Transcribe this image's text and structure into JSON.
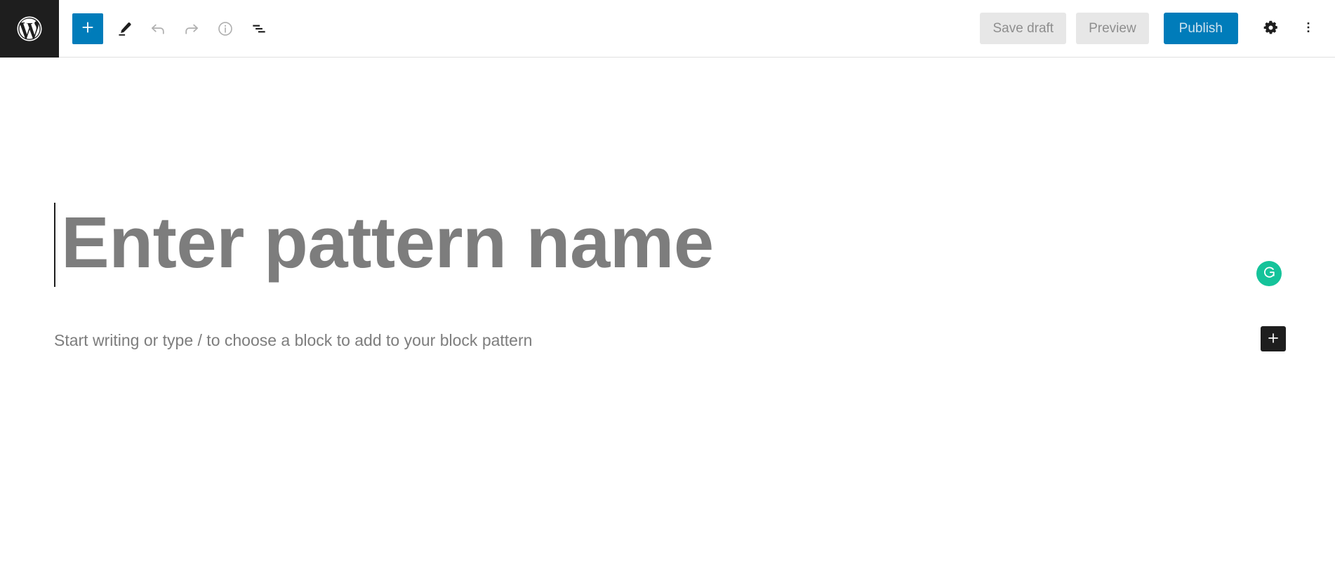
{
  "header": {
    "logo": {
      "icon": "wordpress-logo-icon",
      "label": "WordPress"
    },
    "left_tools": [
      {
        "icon": "plus-icon",
        "label": "Toggle block inserter",
        "state": "active"
      },
      {
        "icon": "pencil-icon",
        "label": "Tools",
        "state": "enabled"
      },
      {
        "icon": "undo-arrow-icon",
        "label": "Undo",
        "state": "disabled"
      },
      {
        "icon": "redo-arrow-icon",
        "label": "Redo",
        "state": "disabled"
      },
      {
        "icon": "info-circle-icon",
        "label": "Details",
        "state": "disabled"
      },
      {
        "icon": "list-view-icon",
        "label": "List View",
        "state": "enabled"
      }
    ],
    "right_tools": {
      "save_draft_label": "Save draft",
      "preview_label": "Preview",
      "publish_label": "Publish",
      "settings_icon": "gear-icon",
      "settings_label": "Settings",
      "more_icon": "kebab-menu-icon",
      "more_label": "Options"
    }
  },
  "editor": {
    "title_placeholder": "Enter pattern name",
    "paragraph_placeholder": "Start writing or type / to choose a block to add to your block pattern",
    "grammarly": {
      "icon": "grammarly-icon",
      "label": "Grammarly"
    },
    "inserter": {
      "icon": "plus-icon",
      "label": "Add block"
    }
  },
  "colors": {
    "brand_blue": "#007cba",
    "dark": "#1e1e1e",
    "button_gray": "#e7e7e7",
    "placeholder_gray": "#7d7d7d",
    "grammarly_green": "#15c39a"
  }
}
